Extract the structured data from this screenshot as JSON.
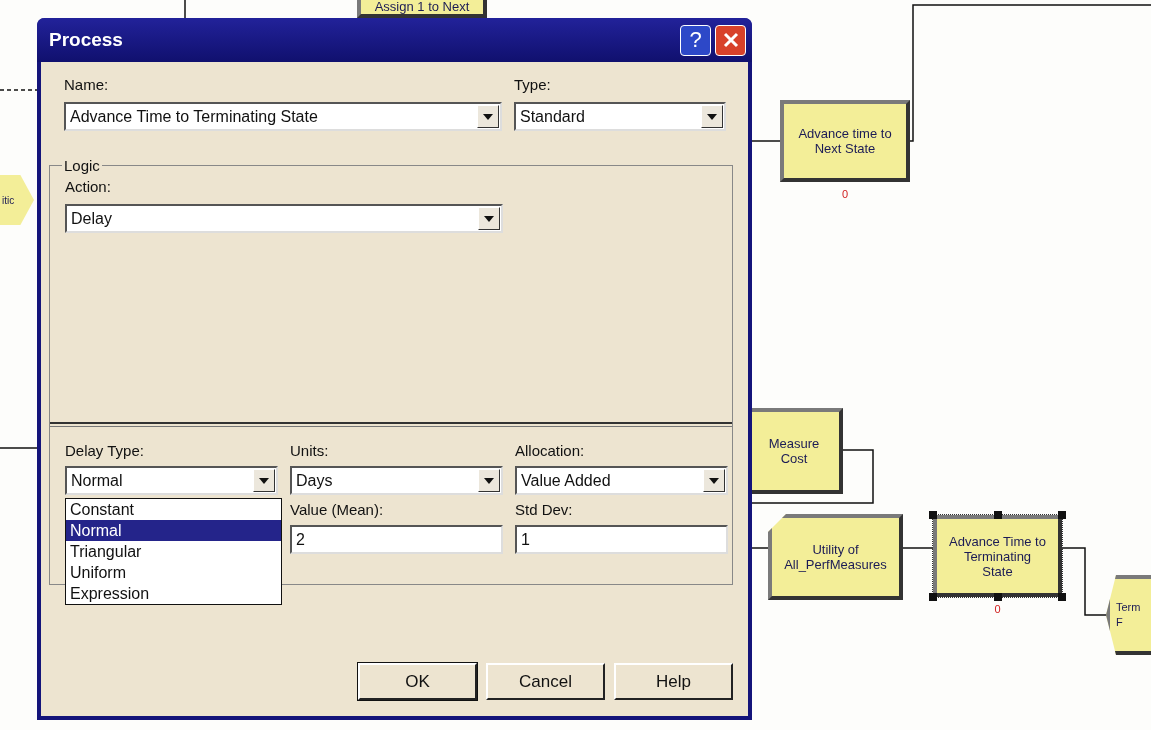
{
  "canvas": {
    "nodes": [
      {
        "kind": "process",
        "lines": [
          "Assign 1 to Next"
        ],
        "selected": false
      },
      {
        "kind": "decide",
        "lines": [
          "itic"
        ],
        "selected": false
      },
      {
        "kind": "process",
        "lines": [
          "Advance time to",
          "Next State"
        ],
        "counter": "0",
        "selected": false
      },
      {
        "kind": "process",
        "lines": [
          "Measure",
          "Cost"
        ],
        "selected": false
      },
      {
        "kind": "record",
        "lines": [
          "Utility of",
          "All_PerfMeasures"
        ],
        "selected": false
      },
      {
        "kind": "process",
        "lines": [
          "Advance Time to",
          "Terminating",
          "State"
        ],
        "counter": "0",
        "selected": true
      },
      {
        "kind": "dispose",
        "lines": [
          "Term",
          "F"
        ],
        "selected": false
      }
    ]
  },
  "dialog": {
    "title": "Process",
    "help_button": "?",
    "name": {
      "label": "Name:",
      "value": "Advance Time to Terminating State"
    },
    "type": {
      "label": "Type:",
      "value": "Standard"
    },
    "logic": {
      "legend": "Logic",
      "action": {
        "label": "Action:",
        "value": "Delay"
      },
      "delay_type": {
        "label": "Delay Type:",
        "value": "Normal",
        "expanded": true,
        "options": [
          {
            "label": "Constant",
            "selected": false
          },
          {
            "label": "Normal",
            "selected": true
          },
          {
            "label": "Triangular",
            "selected": false
          },
          {
            "label": "Uniform",
            "selected": false
          },
          {
            "label": "Expression",
            "selected": false
          }
        ]
      },
      "units": {
        "label": "Units:",
        "value": "Days"
      },
      "allocation": {
        "label": "Allocation:",
        "value": "Value Added"
      },
      "value_mean": {
        "label": "Value (Mean):",
        "value": "2"
      },
      "std_dev": {
        "label": "Std Dev:",
        "value": "1"
      }
    },
    "buttons": [
      {
        "label": "OK",
        "default": true
      },
      {
        "label": "Cancel",
        "default": false
      },
      {
        "label": "Help",
        "default": false
      }
    ]
  }
}
